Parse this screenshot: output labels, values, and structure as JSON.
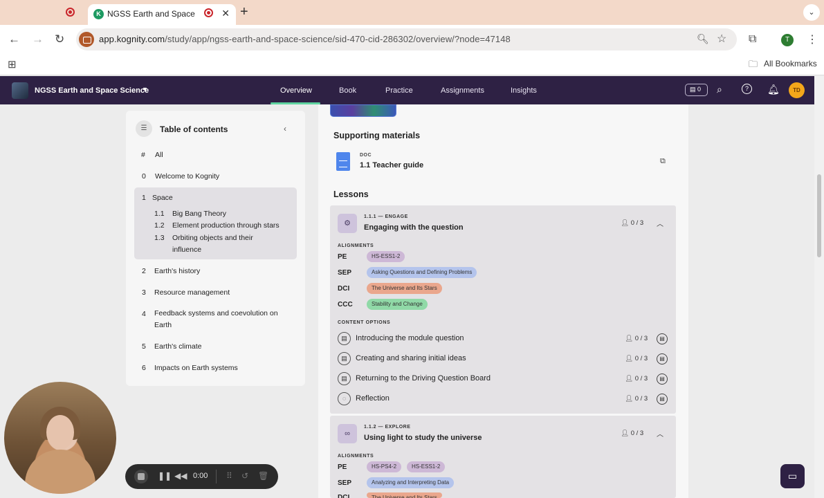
{
  "browser": {
    "tab_title": "NGSS Earth and Space Science",
    "tab_close": "✕",
    "new_tab": "+",
    "tab_menu": "⌄",
    "url_host": "app.kognity.com",
    "url_path": "/study/app/ngss-earth-and-space-science/sid-470-cid-286302/overview/?node=47148",
    "profile_initial": "T",
    "bookmarks_label": "All Bookmarks"
  },
  "app": {
    "title": "NGSS Earth and Space Science",
    "nav": [
      "Overview",
      "Book",
      "Practice",
      "Assignments",
      "Insights"
    ],
    "active_nav": "Overview",
    "badge_count": "0",
    "avatar_initials": "TD"
  },
  "toc": {
    "title": "Table of contents",
    "items": [
      {
        "num": "#",
        "label": "All"
      },
      {
        "num": "0",
        "label": "Welcome to Kognity"
      },
      {
        "num": "1",
        "label": "Space"
      },
      {
        "num": "2",
        "label": "Earth's history"
      },
      {
        "num": "3",
        "label": "Resource management"
      },
      {
        "num": "4",
        "label": "Feedback systems and coevolution on Earth"
      },
      {
        "num": "5",
        "label": "Earth's climate"
      },
      {
        "num": "6",
        "label": "Impacts on Earth systems"
      }
    ],
    "subitems": [
      {
        "num": "1.1",
        "label": "Big Bang Theory"
      },
      {
        "num": "1.2",
        "label": "Element production through stars"
      },
      {
        "num": "1.3",
        "label": "Orbiting objects and their influence"
      }
    ]
  },
  "main": {
    "supporting_title": "Supporting materials",
    "doc": {
      "type": "DOC",
      "name": "1.1 Teacher guide"
    },
    "lessons_title": "Lessons",
    "alignments_label": "ALIGNMENTS",
    "content_options_label": "CONTENT OPTIONS",
    "lessons": [
      {
        "kicker": "1.1.1 — ENGAGE",
        "title": "Engaging with the question",
        "count": "0 / 3",
        "pe": [
          "HS-ESS1-2"
        ],
        "sep": [
          "Asking Questions and Defining Problems"
        ],
        "dci": [
          "The Universe and Its Stars"
        ],
        "ccc": [
          "Stability and Change"
        ],
        "options": [
          {
            "label": "Introducing the module question",
            "count": "0 / 3"
          },
          {
            "label": "Creating and sharing initial ideas",
            "count": "0 / 3"
          },
          {
            "label": "Returning to the Driving Question Board",
            "count": "0 / 3"
          },
          {
            "label": "Reflection",
            "count": "0 / 3"
          }
        ]
      },
      {
        "kicker": "1.1.2 — EXPLORE",
        "title": "Using light to study the universe",
        "count": "0 / 3",
        "pe": [
          "HS-PS4-2",
          "HS-ESS1-2"
        ],
        "sep": [
          "Analyzing and Interpreting Data"
        ],
        "dci": [
          "The Universe and Its Stars"
        ]
      }
    ],
    "align_keys": {
      "pe": "PE",
      "sep": "SEP",
      "dci": "DCI",
      "ccc": "CCC"
    }
  },
  "recorder": {
    "time": "0:00"
  },
  "colors": {
    "brand": "#2e2144",
    "accent": "#5fd3a0",
    "avatar": "#f3a71a"
  }
}
